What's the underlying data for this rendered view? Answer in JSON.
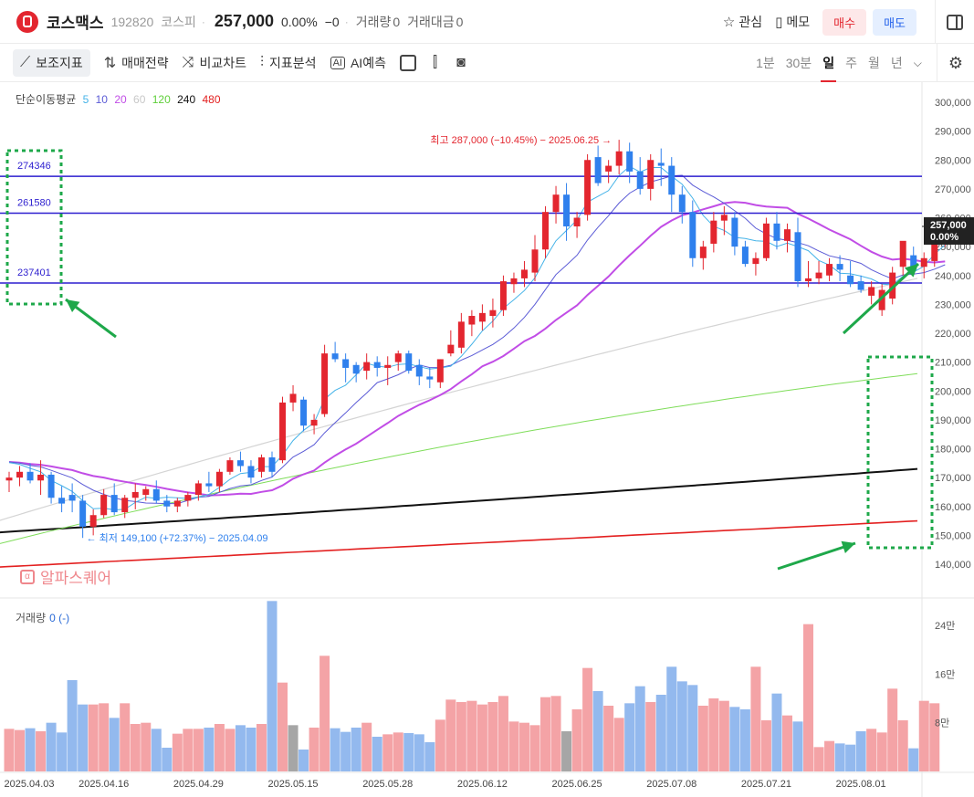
{
  "header": {
    "stock_name": "코스맥스",
    "stock_code": "192820",
    "market": "코스피",
    "price": "257,000",
    "change_pct": "0.00%",
    "change_abs": "0",
    "volume_label": "거래량",
    "volume_value": "0",
    "amount_label": "거래대금",
    "amount_value": "0",
    "watch_label": "관심",
    "memo_label": "메모",
    "buy_label": "매수",
    "sell_label": "매도"
  },
  "toolbar": {
    "tools": [
      "보조지표",
      "매매전략",
      "비교차트",
      "지표분석",
      "AI예측"
    ],
    "timeframes": [
      "1분",
      "30분",
      "일",
      "주",
      "월",
      "년"
    ],
    "active_timeframe": "일"
  },
  "legend": {
    "title": "단순이동평균",
    "periods": [
      {
        "label": "5",
        "color": "#45b3e8"
      },
      {
        "label": "10",
        "color": "#5b5bd6"
      },
      {
        "label": "20",
        "color": "#c14de6"
      },
      {
        "label": "60",
        "color": "#cfcfcf"
      },
      {
        "label": "120",
        "color": "#7fdd5a"
      },
      {
        "label": "240",
        "color": "#111111"
      },
      {
        "label": "480",
        "color": "#e32020"
      }
    ]
  },
  "annotations": {
    "max_label": "최고 287,000 (−10.45%) − 2025.06.25",
    "min_label": "최저 149,100 (+72.37%) − 2025.04.09",
    "hlines": [
      {
        "label": "274346",
        "value": 274346
      },
      {
        "label": "261580",
        "value": 261580
      },
      {
        "label": "237401",
        "value": 237401
      }
    ],
    "current_price_label": "257,000",
    "current_pct_label": "0.00%"
  },
  "watermark": "알파스퀘어",
  "volume_panel": {
    "title": "거래량",
    "value": "0 (-)",
    "axis_labels": [
      "24만",
      "16만",
      "8만"
    ],
    "axis_values": [
      240000,
      160000,
      80000
    ]
  },
  "chart_data": {
    "type": "candlestick",
    "y_axis_ticks": [
      "300,000",
      "290,000",
      "280,000",
      "270,000",
      "260,000",
      "250,000",
      "240,000",
      "230,000",
      "220,000",
      "210,000",
      "200,000",
      "190,000",
      "180,000",
      "170,000",
      "160,000",
      "150,000",
      "140,000"
    ],
    "ylim": [
      135000,
      305000
    ],
    "x_tick_labels": [
      {
        "index": 0,
        "label": "2025.04.03"
      },
      {
        "index": 9,
        "label": "2025.04.16"
      },
      {
        "index": 18,
        "label": "2025.04.29"
      },
      {
        "index": 27,
        "label": "2025.05.15"
      },
      {
        "index": 36,
        "label": "2025.05.28"
      },
      {
        "index": 45,
        "label": "2025.06.12"
      },
      {
        "index": 54,
        "label": "2025.06.25"
      },
      {
        "index": 63,
        "label": "2025.07.08"
      },
      {
        "index": 72,
        "label": "2025.07.21"
      },
      {
        "index": 81,
        "label": "2025.08.01"
      }
    ],
    "candles": [
      [
        169000,
        172000,
        165000,
        170000
      ],
      [
        170000,
        174000,
        167000,
        172000
      ],
      [
        172000,
        175000,
        168000,
        169000
      ],
      [
        169000,
        176000,
        164000,
        171000
      ],
      [
        171000,
        172000,
        161000,
        163000
      ],
      [
        163000,
        167000,
        158000,
        161000
      ],
      [
        164000,
        168000,
        158000,
        162000
      ],
      [
        162000,
        164000,
        149100,
        153000
      ],
      [
        153000,
        159000,
        150000,
        157000
      ],
      [
        157000,
        166000,
        156000,
        164000
      ],
      [
        164000,
        168000,
        157000,
        158000
      ],
      [
        158000,
        164000,
        156000,
        163000
      ],
      [
        163000,
        168000,
        159000,
        165000
      ],
      [
        164000,
        167000,
        162000,
        166000
      ],
      [
        166000,
        169000,
        161000,
        162000
      ],
      [
        162000,
        164000,
        158000,
        160000
      ],
      [
        160000,
        163000,
        158000,
        162000
      ],
      [
        162000,
        165000,
        160000,
        164000
      ],
      [
        164000,
        169000,
        162000,
        168000
      ],
      [
        168000,
        172000,
        165000,
        167000
      ],
      [
        167000,
        173000,
        165000,
        172000
      ],
      [
        172000,
        177000,
        171000,
        176000
      ],
      [
        176000,
        179000,
        172000,
        174000
      ],
      [
        174000,
        176000,
        168000,
        170000
      ],
      [
        172000,
        178000,
        170000,
        177000
      ],
      [
        177000,
        179000,
        170000,
        172000
      ],
      [
        176000,
        198000,
        175000,
        196000
      ],
      [
        196000,
        202000,
        193000,
        199000
      ],
      [
        197000,
        198000,
        186000,
        188000
      ],
      [
        188000,
        192000,
        185000,
        190000
      ],
      [
        192000,
        216000,
        191000,
        213000
      ],
      [
        213000,
        217000,
        210000,
        211000
      ],
      [
        211000,
        213000,
        203000,
        208000
      ],
      [
        209000,
        210000,
        203000,
        206000
      ],
      [
        207000,
        213000,
        204000,
        210000
      ],
      [
        210000,
        212000,
        205000,
        208000
      ],
      [
        208000,
        212000,
        202000,
        209000
      ],
      [
        210000,
        214000,
        207000,
        213000
      ],
      [
        213000,
        214000,
        206000,
        207000
      ],
      [
        209000,
        211000,
        202000,
        205000
      ],
      [
        205000,
        208000,
        201000,
        204000
      ],
      [
        203000,
        211000,
        201000,
        211000
      ],
      [
        213000,
        221000,
        212000,
        216000
      ],
      [
        215000,
        227000,
        213000,
        224000
      ],
      [
        223000,
        228000,
        219000,
        226000
      ],
      [
        224000,
        230000,
        221000,
        227000
      ],
      [
        226000,
        232000,
        222000,
        228000
      ],
      [
        228000,
        240000,
        226000,
        238000
      ],
      [
        237000,
        241000,
        234000,
        239000
      ],
      [
        239000,
        245000,
        236000,
        242000
      ],
      [
        241000,
        254000,
        238000,
        249000
      ],
      [
        249000,
        264000,
        246000,
        262000
      ],
      [
        262000,
        271000,
        258000,
        268000
      ],
      [
        268000,
        272000,
        252000,
        257000
      ],
      [
        257000,
        262000,
        253000,
        260000
      ],
      [
        261000,
        282000,
        259000,
        280000
      ],
      [
        281000,
        285000,
        271000,
        272000
      ],
      [
        276000,
        280000,
        272000,
        278000
      ],
      [
        278000,
        287000,
        275000,
        283000
      ],
      [
        283000,
        286000,
        272000,
        276000
      ],
      [
        276000,
        281000,
        268000,
        270000
      ],
      [
        270000,
        282000,
        266000,
        280000
      ],
      [
        279000,
        284000,
        271000,
        278000
      ],
      [
        278000,
        281000,
        262000,
        268000
      ],
      [
        268000,
        271000,
        258000,
        262000
      ],
      [
        262000,
        266000,
        243000,
        246000
      ],
      [
        246000,
        252000,
        242000,
        250000
      ],
      [
        251000,
        262000,
        248000,
        259000
      ],
      [
        259000,
        264000,
        254000,
        261000
      ],
      [
        260000,
        262000,
        247000,
        250000
      ],
      [
        250000,
        252000,
        243000,
        244000
      ],
      [
        244000,
        248000,
        240000,
        246000
      ],
      [
        246000,
        260000,
        245000,
        258000
      ],
      [
        258000,
        262000,
        249000,
        252000
      ],
      [
        252000,
        258000,
        248000,
        256000
      ],
      [
        255000,
        260000,
        236000,
        238000
      ],
      [
        238000,
        245000,
        236000,
        239000
      ],
      [
        239000,
        245000,
        237000,
        241000
      ],
      [
        240000,
        246000,
        238000,
        244000
      ],
      [
        244000,
        247000,
        238000,
        242000
      ],
      [
        240000,
        245000,
        236000,
        237000
      ],
      [
        238000,
        240000,
        234000,
        235000
      ],
      [
        233000,
        238000,
        230000,
        236000
      ],
      [
        228000,
        237000,
        226000,
        235000
      ],
      [
        232000,
        243000,
        230000,
        241000
      ],
      [
        243000,
        251000,
        240000,
        252000
      ],
      [
        247000,
        250000,
        240000,
        242000
      ],
      [
        243000,
        248000,
        239000,
        246000
      ],
      [
        245000,
        257000,
        243000,
        256000
      ],
      [
        255000,
        259000,
        250000,
        257000
      ]
    ],
    "volume": [
      70000,
      68000,
      71000,
      66000,
      80000,
      64000,
      150000,
      110000,
      110000,
      112000,
      88000,
      112000,
      78000,
      80000,
      70000,
      39000,
      62000,
      70000,
      70000,
      72000,
      78000,
      70000,
      76000,
      72000,
      78000,
      280000,
      146000,
      76000,
      36000,
      72000,
      190000,
      71000,
      65000,
      72000,
      80000,
      57000,
      61000,
      64000,
      63000,
      61000,
      48000,
      85000,
      118000,
      114000,
      116000,
      110000,
      114000,
      124000,
      82000,
      80000,
      76000,
      122000,
      124000,
      66000,
      102000,
      170000,
      132000,
      108000,
      88000,
      112000,
      140000,
      114000,
      126000,
      172000,
      148000,
      142000,
      108000,
      120000,
      116000,
      106000,
      102000,
      172000,
      84000,
      128000,
      92000,
      82000,
      242000,
      40000,
      50000,
      46000,
      44000,
      66000,
      70000,
      64000,
      136000,
      84000,
      38000,
      116000,
      112000
    ],
    "ma_series": [
      {
        "period": 5,
        "color": "#45b3e8"
      },
      {
        "period": 10,
        "color": "#5b5bd6"
      },
      {
        "period": 20,
        "color": "#c14de6"
      },
      {
        "period": 60,
        "color": "#d4d4d4"
      },
      {
        "period": 120,
        "color": "#7fdd5a"
      },
      {
        "period": 240,
        "color": "#111111"
      },
      {
        "period": 480,
        "color": "#e32020"
      }
    ],
    "long_ma_endpoints": {
      "60": [
        155000,
        239000
      ],
      "120": [
        147000,
        206000
      ],
      "240": [
        151000,
        173000
      ],
      "480": [
        139000,
        155000
      ]
    },
    "prior_closes": [
      176000,
      177000,
      178000,
      176000,
      175000,
      174000,
      174000,
      175000,
      176000,
      175000,
      174000,
      176000,
      177000,
      176000,
      175000,
      174000,
      175000,
      176000,
      177000,
      178000
    ]
  }
}
